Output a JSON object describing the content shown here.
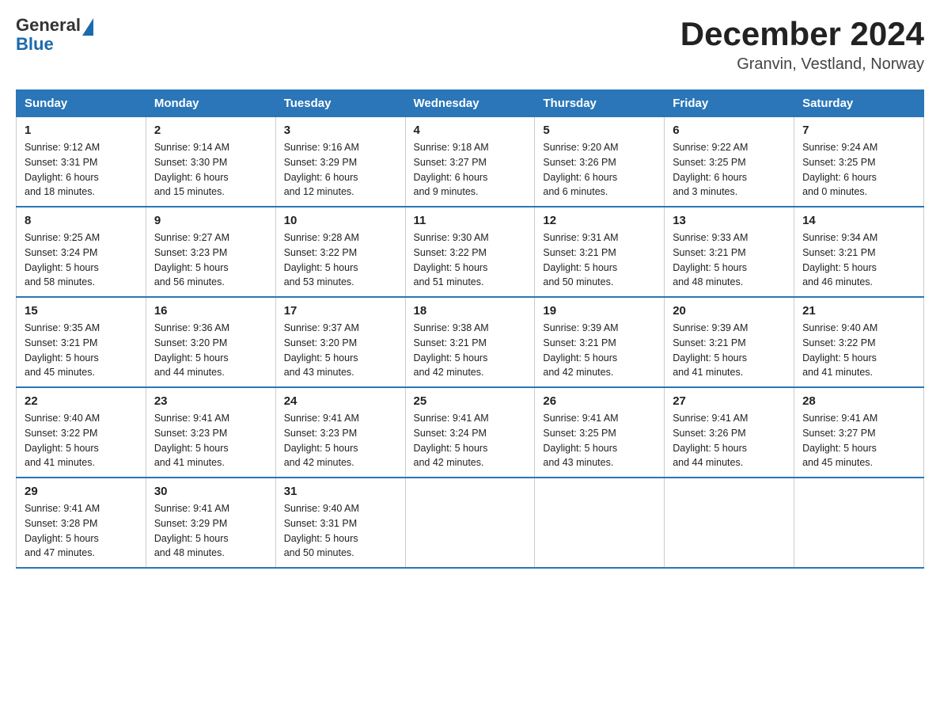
{
  "header": {
    "logo": {
      "text1": "General",
      "text2": "Blue"
    },
    "title": "December 2024",
    "location": "Granvin, Vestland, Norway"
  },
  "weekdays": [
    "Sunday",
    "Monday",
    "Tuesday",
    "Wednesday",
    "Thursday",
    "Friday",
    "Saturday"
  ],
  "weeks": [
    [
      {
        "day": "1",
        "sunrise": "9:12 AM",
        "sunset": "3:31 PM",
        "daylight": "6 hours and 18 minutes."
      },
      {
        "day": "2",
        "sunrise": "9:14 AM",
        "sunset": "3:30 PM",
        "daylight": "6 hours and 15 minutes."
      },
      {
        "day": "3",
        "sunrise": "9:16 AM",
        "sunset": "3:29 PM",
        "daylight": "6 hours and 12 minutes."
      },
      {
        "day": "4",
        "sunrise": "9:18 AM",
        "sunset": "3:27 PM",
        "daylight": "6 hours and 9 minutes."
      },
      {
        "day": "5",
        "sunrise": "9:20 AM",
        "sunset": "3:26 PM",
        "daylight": "6 hours and 6 minutes."
      },
      {
        "day": "6",
        "sunrise": "9:22 AM",
        "sunset": "3:25 PM",
        "daylight": "6 hours and 3 minutes."
      },
      {
        "day": "7",
        "sunrise": "9:24 AM",
        "sunset": "3:25 PM",
        "daylight": "6 hours and 0 minutes."
      }
    ],
    [
      {
        "day": "8",
        "sunrise": "9:25 AM",
        "sunset": "3:24 PM",
        "daylight": "5 hours and 58 minutes."
      },
      {
        "day": "9",
        "sunrise": "9:27 AM",
        "sunset": "3:23 PM",
        "daylight": "5 hours and 56 minutes."
      },
      {
        "day": "10",
        "sunrise": "9:28 AM",
        "sunset": "3:22 PM",
        "daylight": "5 hours and 53 minutes."
      },
      {
        "day": "11",
        "sunrise": "9:30 AM",
        "sunset": "3:22 PM",
        "daylight": "5 hours and 51 minutes."
      },
      {
        "day": "12",
        "sunrise": "9:31 AM",
        "sunset": "3:21 PM",
        "daylight": "5 hours and 50 minutes."
      },
      {
        "day": "13",
        "sunrise": "9:33 AM",
        "sunset": "3:21 PM",
        "daylight": "5 hours and 48 minutes."
      },
      {
        "day": "14",
        "sunrise": "9:34 AM",
        "sunset": "3:21 PM",
        "daylight": "5 hours and 46 minutes."
      }
    ],
    [
      {
        "day": "15",
        "sunrise": "9:35 AM",
        "sunset": "3:21 PM",
        "daylight": "5 hours and 45 minutes."
      },
      {
        "day": "16",
        "sunrise": "9:36 AM",
        "sunset": "3:20 PM",
        "daylight": "5 hours and 44 minutes."
      },
      {
        "day": "17",
        "sunrise": "9:37 AM",
        "sunset": "3:20 PM",
        "daylight": "5 hours and 43 minutes."
      },
      {
        "day": "18",
        "sunrise": "9:38 AM",
        "sunset": "3:21 PM",
        "daylight": "5 hours and 42 minutes."
      },
      {
        "day": "19",
        "sunrise": "9:39 AM",
        "sunset": "3:21 PM",
        "daylight": "5 hours and 42 minutes."
      },
      {
        "day": "20",
        "sunrise": "9:39 AM",
        "sunset": "3:21 PM",
        "daylight": "5 hours and 41 minutes."
      },
      {
        "day": "21",
        "sunrise": "9:40 AM",
        "sunset": "3:22 PM",
        "daylight": "5 hours and 41 minutes."
      }
    ],
    [
      {
        "day": "22",
        "sunrise": "9:40 AM",
        "sunset": "3:22 PM",
        "daylight": "5 hours and 41 minutes."
      },
      {
        "day": "23",
        "sunrise": "9:41 AM",
        "sunset": "3:23 PM",
        "daylight": "5 hours and 41 minutes."
      },
      {
        "day": "24",
        "sunrise": "9:41 AM",
        "sunset": "3:23 PM",
        "daylight": "5 hours and 42 minutes."
      },
      {
        "day": "25",
        "sunrise": "9:41 AM",
        "sunset": "3:24 PM",
        "daylight": "5 hours and 42 minutes."
      },
      {
        "day": "26",
        "sunrise": "9:41 AM",
        "sunset": "3:25 PM",
        "daylight": "5 hours and 43 minutes."
      },
      {
        "day": "27",
        "sunrise": "9:41 AM",
        "sunset": "3:26 PM",
        "daylight": "5 hours and 44 minutes."
      },
      {
        "day": "28",
        "sunrise": "9:41 AM",
        "sunset": "3:27 PM",
        "daylight": "5 hours and 45 minutes."
      }
    ],
    [
      {
        "day": "29",
        "sunrise": "9:41 AM",
        "sunset": "3:28 PM",
        "daylight": "5 hours and 47 minutes."
      },
      {
        "day": "30",
        "sunrise": "9:41 AM",
        "sunset": "3:29 PM",
        "daylight": "5 hours and 48 minutes."
      },
      {
        "day": "31",
        "sunrise": "9:40 AM",
        "sunset": "3:31 PM",
        "daylight": "5 hours and 50 minutes."
      },
      null,
      null,
      null,
      null
    ]
  ],
  "labels": {
    "sunrise": "Sunrise:",
    "sunset": "Sunset:",
    "daylight": "Daylight:"
  }
}
